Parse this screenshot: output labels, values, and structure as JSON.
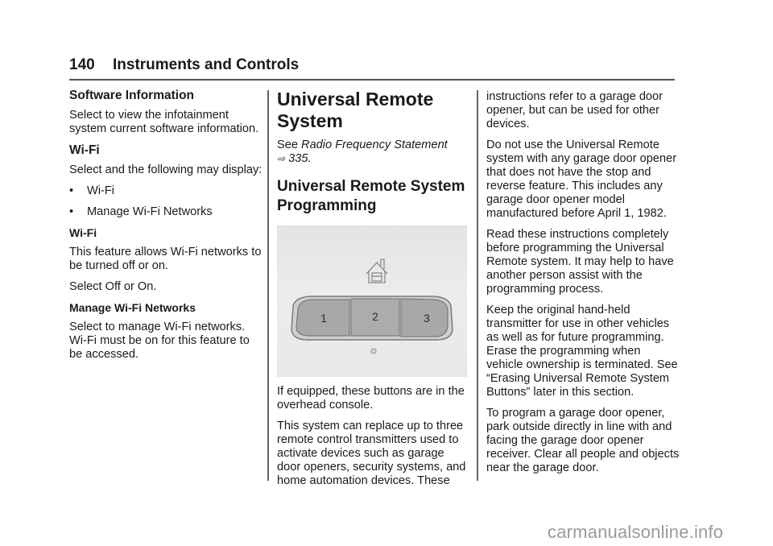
{
  "header": {
    "page_number": "140",
    "section_title": "Instruments and Controls"
  },
  "column1": {
    "software_info": {
      "heading": "Software Information",
      "text": "Select to view the infotainment system current software information."
    },
    "wifi": {
      "heading": "Wi-Fi",
      "intro": "Select and the following may display:",
      "bullets": [
        "Wi-Fi",
        "Manage Wi-Fi Networks"
      ],
      "bullet_glyph": "•",
      "sub1_heading": "Wi-Fi",
      "sub1_text": "This feature allows Wi-Fi networks to be turned off or on.",
      "sub1_text2": "Select Off or On.",
      "sub2_heading": "Manage Wi-Fi Networks",
      "sub2_text": "Select to manage Wi-Fi networks. Wi-Fi must be on for this feature to be accessed."
    }
  },
  "column2": {
    "title": "Universal Remote System",
    "see_prefix": "See ",
    "see_ref": "Radio Frequency Statement",
    "see_arrow": "⇨",
    "see_page": " 335.",
    "subtitle": "Universal Remote System Programming",
    "figure": {
      "icon": "garage-home-icon",
      "buttons": [
        "1",
        "2",
        "3"
      ],
      "indicator": "indicator-light"
    },
    "para1": "If equipped, these buttons are in the overhead console.",
    "para2": "This system can replace up to three remote control transmitters used to activate devices such as garage door openers, security systems, and home automation devices. These"
  },
  "column3": {
    "para1": "instructions refer to a garage door opener, but can be used for other devices.",
    "para2": "Do not use the Universal Remote system with any garage door opener that does not have the stop and reverse feature. This includes any garage door opener model manufactured before April 1, 1982.",
    "para3": "Read these instructions completely before programming the Universal Remote system. It may help to have another person assist with the programming process.",
    "para4": "Keep the original hand-held transmitter for use in other vehicles as well as for future programming. Erase the programming when vehicle ownership is terminated. See “Erasing Universal Remote System Buttons” later in this section.",
    "para5": "To program a garage door opener, park outside directly in line with and facing the garage door opener receiver. Clear all people and objects near the garage door."
  },
  "watermark": "carmanualsonline.info"
}
